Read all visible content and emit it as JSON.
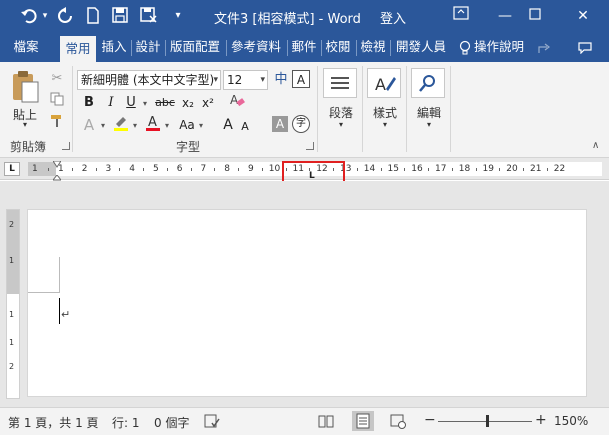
{
  "window": {
    "title": "文件3 [相容模式]  -  Word",
    "signin": "登入"
  },
  "quick_access": {
    "undo_icon": "undo-icon",
    "redo_icon": "redo-icon",
    "new_icon": "new-document-icon",
    "save_icon": "save-icon",
    "saveas_icon": "save-as-icon"
  },
  "tabs": [
    {
      "label": "檔案"
    },
    {
      "label": "常用"
    },
    {
      "label": "插入"
    },
    {
      "label": "設計"
    },
    {
      "label": "版面配置"
    },
    {
      "label": "參考資料"
    },
    {
      "label": "郵件"
    },
    {
      "label": "校閱"
    },
    {
      "label": "檢視"
    },
    {
      "label": "開發人員"
    },
    {
      "label": "操作說明"
    }
  ],
  "ribbon": {
    "clipboard": {
      "paste_label": "貼上",
      "group_label": "剪貼簿"
    },
    "font": {
      "font_name": "新細明體 (本文中文字型)",
      "font_size": "12",
      "group_label": "字型",
      "bold": "B",
      "italic": "I",
      "underline": "U",
      "strike": "abc",
      "subscript": "x₂",
      "superscript": "x²",
      "grow": "A",
      "shrink": "A",
      "aa": "Aa",
      "char_shade": "A",
      "enclose": "字",
      "phonetic": "中",
      "font_color": "#e81123",
      "highlight_color": "#ffff00"
    },
    "paragraph": {
      "label": "段落"
    },
    "styles": {
      "label": "樣式"
    },
    "editing": {
      "label": "編輯"
    }
  },
  "ruler": {
    "ticks": [
      "1",
      "1",
      "2",
      "3",
      "4",
      "5",
      "6",
      "7",
      "8",
      "9",
      "10",
      "11",
      "12",
      "13",
      "14",
      "15",
      "16",
      "17",
      "18",
      "19",
      "20",
      "21",
      "22"
    ],
    "left_tab_marker": "L"
  },
  "vruler": {
    "ticks": [
      "2",
      "1",
      "1",
      "1",
      "2"
    ]
  },
  "document": {
    "paragraph_mark": "↵"
  },
  "status": {
    "page": "第 1 頁，共 1 頁",
    "line": "行: 1",
    "words": "0 個字",
    "zoom": "150%",
    "minus": "−",
    "plus": "+"
  }
}
